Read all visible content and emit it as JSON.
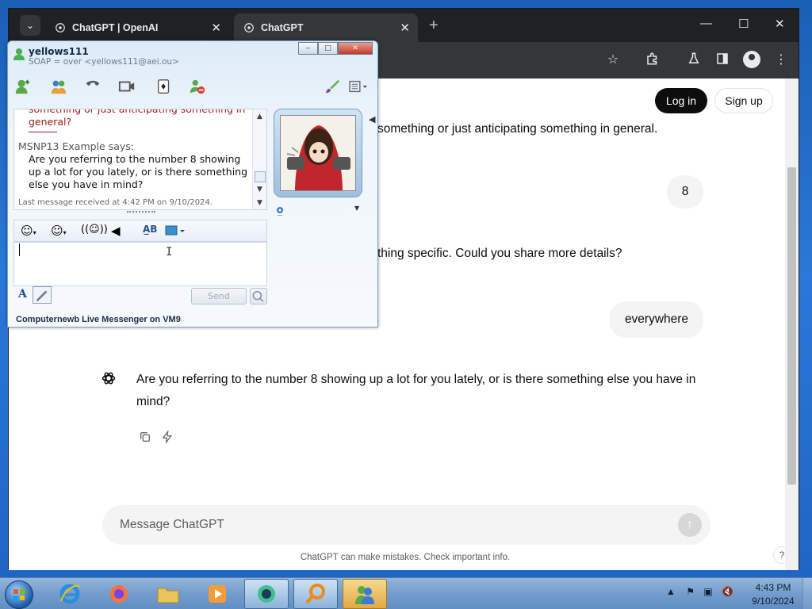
{
  "browser": {
    "tabs": [
      {
        "title": "ChatGPT | OpenAI"
      },
      {
        "title": "ChatGPT"
      }
    ]
  },
  "chat": {
    "login_label": "Log in",
    "signup_label": "Sign up",
    "partial_assistant_1": "something or just anticipating something in general.",
    "user_msg_1": "8",
    "partial_assistant_2": "thing specific. Could you share more details?",
    "user_msg_2": "everywhere",
    "assistant_msg": "Are you referring to the number 8 showing up a lot for you lately, or is there something else you have in mind?",
    "composer_placeholder": "Message ChatGPT",
    "disclaimer": "ChatGPT can make mistakes. Check important info.",
    "help_label": "?"
  },
  "messenger": {
    "contact_name": "yellows111",
    "contact_status": "SOAP = over <yellows111@aei.ou>",
    "prev_message": "something or just anticipating something in general?",
    "sender_says": "MSNP13 Example says:",
    "message": "Are you referring to the number 8 showing up a lot for you lately, or is there something else you have in mind?",
    "last_received": "Last message received at 4:42 PM on 9/10/2024.",
    "send_label": "Send",
    "footer": "Computernewb Live Messenger on VM9",
    "font_label": "A"
  },
  "taskbar": {
    "time": "4:43 PM",
    "date": "9/10/2024"
  },
  "colors": {
    "chrome_dark": "#202124",
    "chrome_toolbar": "#35363a",
    "msn_prev_text": "#9b1a1a",
    "login_bg": "#0d0d0d"
  }
}
